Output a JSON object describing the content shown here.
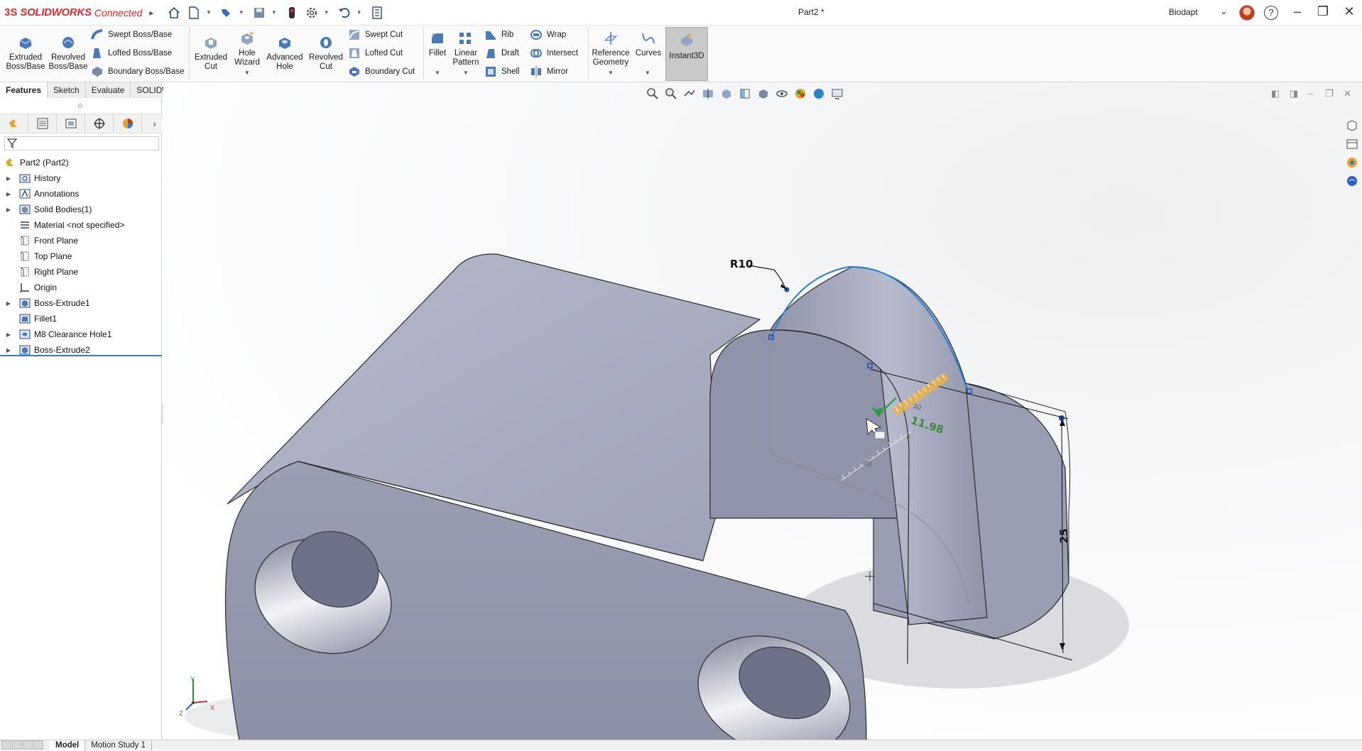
{
  "app": {
    "brand_ds": "3S",
    "brand_name": "SOLIDWORKS",
    "brand_suffix": "Connected",
    "document_title": "Part2 *",
    "user_name": "Biodapt",
    "help_glyph": "?"
  },
  "ribbon": {
    "large_buttons": [
      {
        "id": "extruded-boss",
        "line1": "Extruded",
        "line2": "Boss/Base"
      },
      {
        "id": "revolved-boss",
        "line1": "Revolved",
        "line2": "Boss/Base"
      },
      {
        "id": "extruded-cut",
        "line1": "Extruded",
        "line2": "Cut"
      },
      {
        "id": "hole-wizard",
        "line1": "Hole",
        "line2": "Wizard"
      },
      {
        "id": "advanced-hole",
        "line1": "Advanced",
        "line2": "Hole"
      },
      {
        "id": "revolved-cut",
        "line1": "Revolved",
        "line2": "Cut"
      },
      {
        "id": "fillet",
        "line1": "Fillet",
        "line2": ""
      },
      {
        "id": "linear-pattern",
        "line1": "Linear",
        "line2": "Pattern"
      },
      {
        "id": "reference-geometry",
        "line1": "Reference",
        "line2": "Geometry"
      },
      {
        "id": "curves",
        "line1": "Curves",
        "line2": ""
      },
      {
        "id": "instant3d",
        "line1": "Instant3D",
        "line2": ""
      }
    ],
    "small_buttons": {
      "swept_boss": "Swept Boss/Base",
      "lofted_boss": "Lofted Boss/Base",
      "boundary_boss": "Boundary Boss/Base",
      "swept_cut": "Swept Cut",
      "lofted_cut": "Lofted Cut",
      "boundary_cut": "Boundary Cut",
      "rib": "Rib",
      "draft": "Draft",
      "shell": "Shell",
      "wrap": "Wrap",
      "intersect": "Intersect",
      "mirror": "Mirror"
    }
  },
  "command_tabs": [
    "Features",
    "Sketch",
    "Evaluate",
    "SOLIDWORKS Add-Ins"
  ],
  "feature_tree": {
    "root": "Part2  (Part2)",
    "items": [
      {
        "label": "History",
        "icon": "history-folder-icon",
        "expandable": true
      },
      {
        "label": "Annotations",
        "icon": "annotations-icon",
        "expandable": true
      },
      {
        "label": "Solid Bodies(1)",
        "icon": "solid-bodies-icon",
        "expandable": true
      },
      {
        "label": "Material <not specified>",
        "icon": "material-icon",
        "expandable": false
      },
      {
        "label": "Front Plane",
        "icon": "plane-icon",
        "expandable": false
      },
      {
        "label": "Top Plane",
        "icon": "plane-icon",
        "expandable": false
      },
      {
        "label": "Right Plane",
        "icon": "plane-icon",
        "expandable": false
      },
      {
        "label": "Origin",
        "icon": "origin-icon",
        "expandable": false
      },
      {
        "label": "Boss-Extrude1",
        "icon": "extrude-feature-icon",
        "expandable": true
      },
      {
        "label": "Fillet1",
        "icon": "fillet-feature-icon",
        "expandable": false
      },
      {
        "label": "M8 Clearance Hole1",
        "icon": "hole-feature-icon",
        "expandable": true
      },
      {
        "label": "Boss-Extrude2",
        "icon": "extrude-feature-icon",
        "expandable": true
      }
    ]
  },
  "viewport": {
    "radius_dim": "R10",
    "height_dim": "25",
    "ruler_value": "11.98",
    "ruler_ticks": [
      "10",
      "5",
      "20"
    ],
    "axis_x": "X",
    "axis_y": "Y",
    "axis_z": "Z"
  },
  "status_tabs": [
    "Model",
    "Motion Study 1"
  ],
  "colors": {
    "brand_red": "#d62b2b",
    "selection_blue": "#2b7fd1",
    "part_gray": "#9aa0b6"
  }
}
